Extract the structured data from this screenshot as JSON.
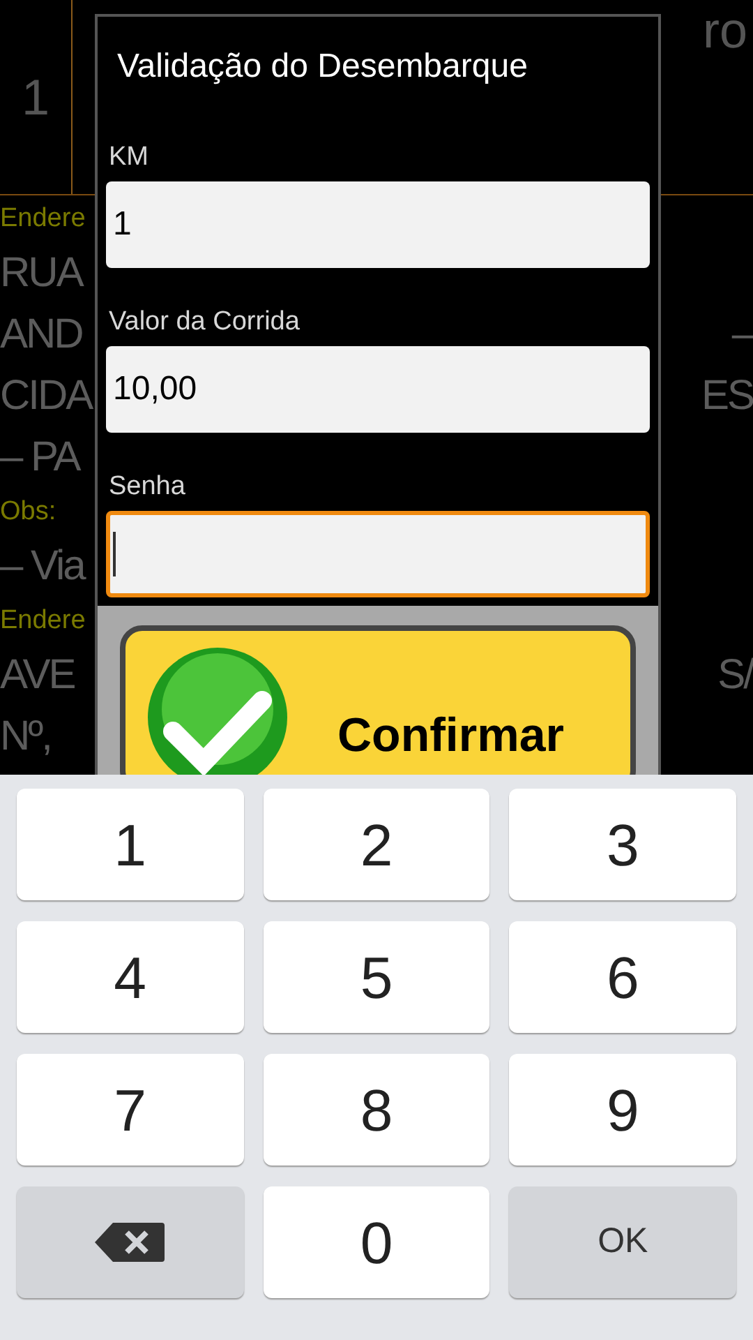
{
  "background": {
    "row_number": "1",
    "header_fragment": "ro",
    "lines": [
      {
        "kind": "label",
        "left": "Endere"
      },
      {
        "kind": "value",
        "left": "RUA"
      },
      {
        "kind": "value",
        "left": "AND",
        "right": "–"
      },
      {
        "kind": "value",
        "left": "CIDA",
        "right": "ES"
      },
      {
        "kind": "value",
        "left": "– PA"
      },
      {
        "kind": "label",
        "left": "Obs:"
      },
      {
        "kind": "value",
        "left": "– Via"
      },
      {
        "kind": "label",
        "left": "Endere"
      },
      {
        "kind": "value",
        "left": "AVE",
        "right": "S/"
      },
      {
        "kind": "value",
        "left": "Nº,"
      }
    ]
  },
  "dialog": {
    "title": "Validação do Desembarque",
    "fields": [
      {
        "label": "KM",
        "value": "1",
        "focused": false
      },
      {
        "label": "Valor da Corrida",
        "value": "10,00",
        "focused": false
      },
      {
        "label": "Senha",
        "focused": true
      }
    ],
    "confirm_button": "Confirmar"
  },
  "keyboard": {
    "keys": [
      {
        "kind": "digit",
        "label": "1"
      },
      {
        "kind": "digit",
        "label": "2"
      },
      {
        "kind": "digit",
        "label": "3"
      },
      {
        "kind": "digit",
        "label": "4"
      },
      {
        "kind": "digit",
        "label": "5"
      },
      {
        "kind": "digit",
        "label": "6"
      },
      {
        "kind": "digit",
        "label": "7"
      },
      {
        "kind": "digit",
        "label": "8"
      },
      {
        "kind": "digit",
        "label": "9"
      },
      {
        "kind": "backspace"
      },
      {
        "kind": "digit",
        "label": "0"
      },
      {
        "kind": "ok",
        "label": "OK"
      }
    ]
  }
}
